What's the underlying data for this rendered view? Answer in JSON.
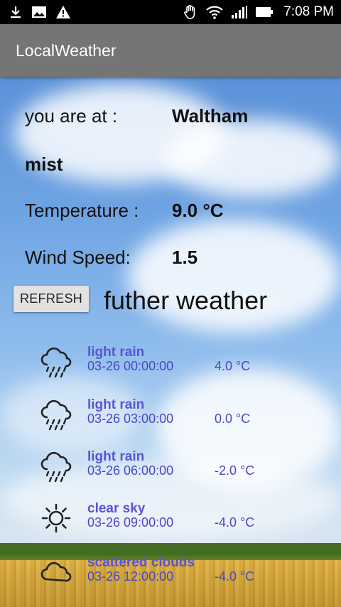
{
  "status_bar": {
    "time": "7:08 PM",
    "left_icons": [
      "download-icon",
      "image-icon",
      "warning-icon"
    ],
    "right_icons": [
      "hand-icon",
      "wifi-icon",
      "signal-icon",
      "battery-icon"
    ]
  },
  "app_bar": {
    "title": "LocalWeather"
  },
  "location": {
    "label": "you are at :",
    "value": "Waltham"
  },
  "condition": "mist",
  "temperature": {
    "label": "Temperature :",
    "value": "9.0 °C"
  },
  "wind": {
    "label": "Wind Speed:",
    "value": "1.5"
  },
  "refresh_label": "REFRESH",
  "further_title": "futher weather",
  "forecast": [
    {
      "icon": "rain-cloud-icon",
      "desc": "light rain",
      "time": "03-26 00:00:00",
      "temp": "4.0 °C"
    },
    {
      "icon": "rain-cloud-icon",
      "desc": "light rain",
      "time": "03-26 03:00:00",
      "temp": "0.0 °C"
    },
    {
      "icon": "rain-cloud-icon",
      "desc": "light rain",
      "time": "03-26 06:00:00",
      "temp": "-2.0 °C"
    },
    {
      "icon": "sun-icon",
      "desc": "clear sky",
      "time": "03-26 09:00:00",
      "temp": "-4.0 °C"
    },
    {
      "icon": "cloud-icon",
      "desc": "scattered clouds",
      "time": "03-26 12:00:00",
      "temp": "-4.0 °C"
    }
  ],
  "colors": {
    "app_bar": "#757575",
    "forecast_text": "#4a46c8",
    "button": "#e2e2e2"
  }
}
